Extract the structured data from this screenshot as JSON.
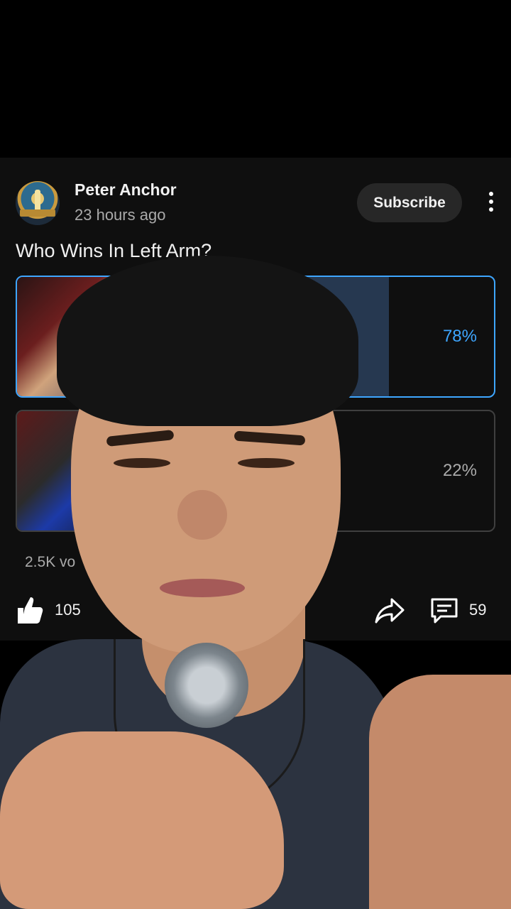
{
  "post": {
    "channel_name": "Peter Anchor",
    "time_ago": "23 hours ago",
    "subscribe_label": "Subscribe",
    "question": "Who Wins In Left Arm?",
    "poll": {
      "options": [
        {
          "percent_label": "78%",
          "percent": 78,
          "selected": true
        },
        {
          "percent_label": "22%",
          "percent": 22,
          "selected": false
        }
      ],
      "votes_label": "2.5K vo"
    },
    "actions": {
      "like_count": "105",
      "comment_count": "59"
    }
  },
  "icons": {
    "more": "more-vert-icon",
    "like": "thumbs-up-icon",
    "share": "share-arrow-icon",
    "comment": "comment-icon"
  },
  "colors": {
    "accent": "#3ea6ff",
    "card_bg": "#0f0f0f",
    "button_bg": "#272727"
  }
}
